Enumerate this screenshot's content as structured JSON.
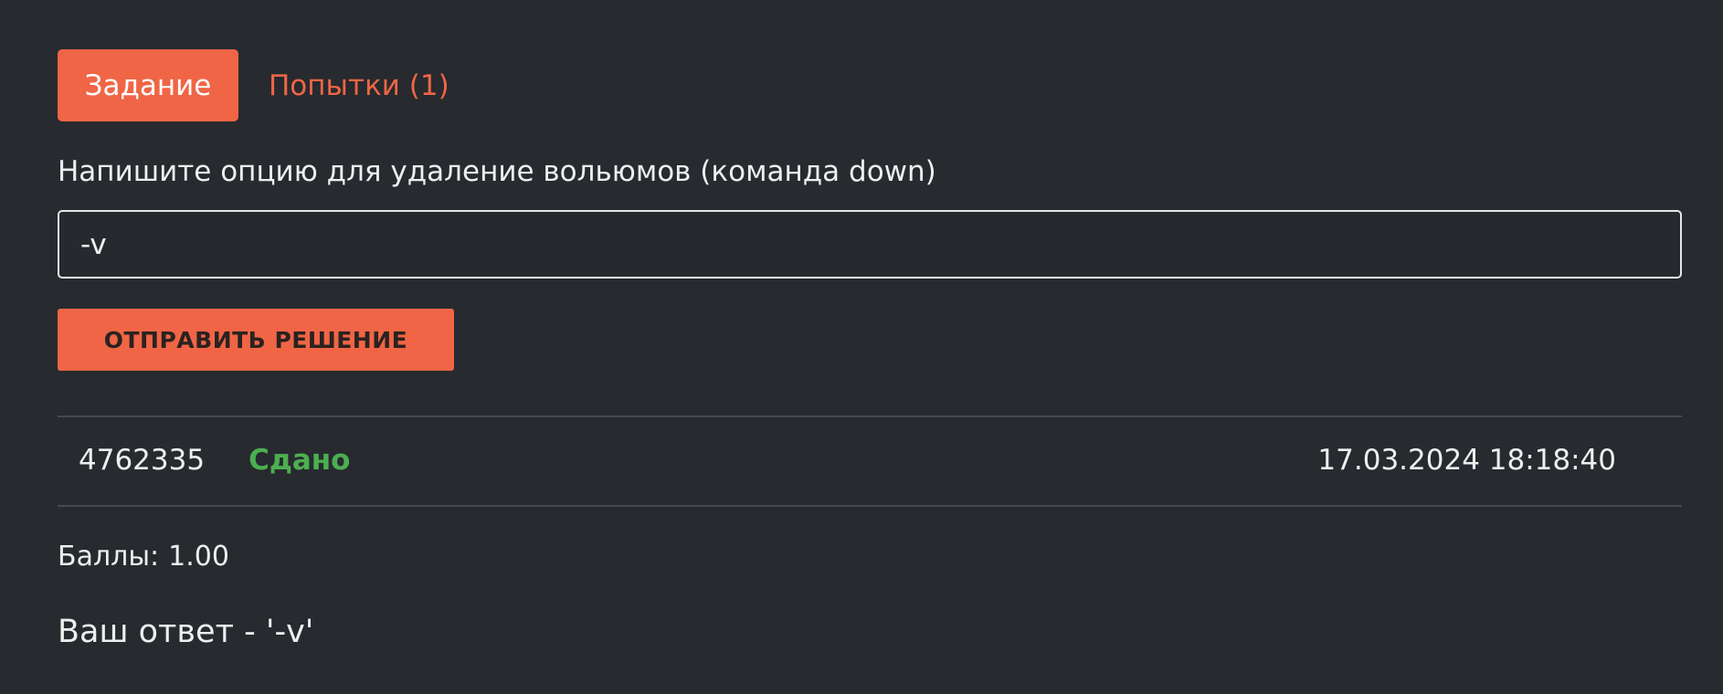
{
  "tabs": {
    "task_label": "Задание",
    "attempts_label": "Попытки (1)"
  },
  "task": {
    "question": "Напишите опцию для удаление вольюмов (команда down)",
    "input_value": "-v",
    "submit_label": "ОТПРАВИТЬ РЕШЕНИЕ"
  },
  "attempt": {
    "id": "4762335",
    "status": "Сдано",
    "datetime": "17.03.2024 18:18:40"
  },
  "result": {
    "score_label": "Баллы:",
    "score_value": "1.00",
    "answer_text": "Ваш ответ - '-v'"
  },
  "colors": {
    "background": "#272a2f",
    "accent": "#f06545",
    "status_success": "#4caf50",
    "text": "#eeeeee"
  }
}
